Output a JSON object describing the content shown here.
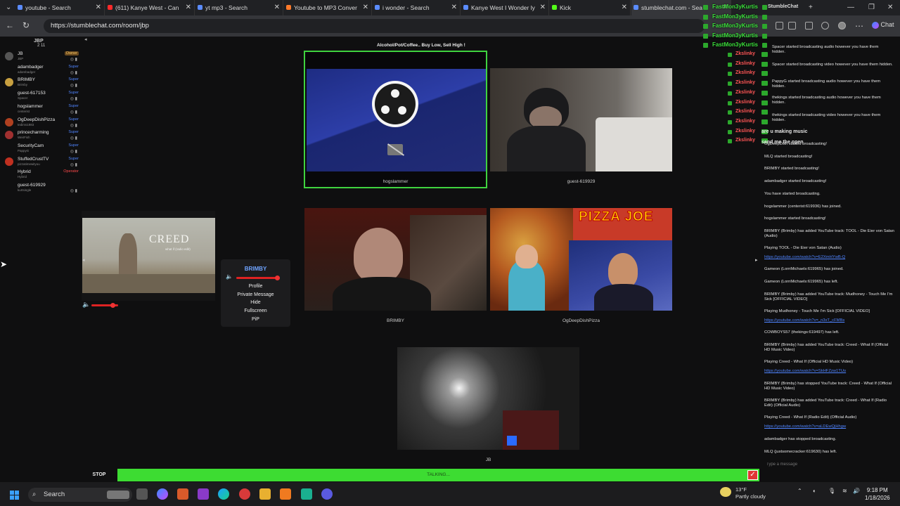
{
  "browser": {
    "tabs": [
      {
        "label": "youtube - Search",
        "color": "#5b8cff"
      },
      {
        "label": "(611) Kanye West - Can",
        "color": "#ff2a2a"
      },
      {
        "label": "yt mp3 - Search",
        "color": "#5b8cff"
      },
      {
        "label": "Youtube to MP3 Conver",
        "color": "#ff7a2a"
      },
      {
        "label": "i wonder - Search",
        "color": "#5b8cff"
      },
      {
        "label": "Kanye West I Wonder ly",
        "color": "#5b8cff"
      },
      {
        "label": "Kick",
        "color": "#53fc18"
      },
      {
        "label": "stumblechat.com - Sea",
        "color": "#5b8cff"
      }
    ],
    "url": "https://stumblechat.com/room/jbp",
    "chat_button": "Chat"
  },
  "room": {
    "name": "JBP",
    "count": "2 11",
    "topic": "Alcohol/Pot/Coffee.. Buy Low, Sell High !"
  },
  "users": [
    {
      "name": "JB",
      "sub": "JBP",
      "role": "Owner",
      "roleType": "owner",
      "avatar": "#555"
    },
    {
      "name": "adambadger",
      "sub": "adambadger",
      "role": "Super",
      "roleType": "super",
      "avatar": ""
    },
    {
      "name": "BRIMBY",
      "sub": "Brimby",
      "role": "Super",
      "roleType": "super",
      "avatar": "#c8a040"
    },
    {
      "name": "guest-617153",
      "sub": "Spacer",
      "role": "Super",
      "roleType": "super",
      "avatar": ""
    },
    {
      "name": "hogslammer",
      "sub": "centerist",
      "role": "Super",
      "roleType": "super",
      "avatar": ""
    },
    {
      "name": "OgDeepDishPizza",
      "sub": "tedims1983",
      "role": "Super",
      "roleType": "super",
      "avatar": "#b04020"
    },
    {
      "name": "princecharming",
      "sub": "WeirFish",
      "role": "Super",
      "roleType": "super",
      "avatar": "#a03030"
    },
    {
      "name": "SecurityCam",
      "sub": "PappyG",
      "role": "Super",
      "roleType": "super",
      "avatar": ""
    },
    {
      "name": "StuffedCrustTV",
      "sub": "pizzatimewityou",
      "role": "Super",
      "roleType": "super",
      "avatar": "#c03020"
    },
    {
      "name": "Hybrid",
      "sub": "Hybrid",
      "role": "Operator",
      "roleType": "op",
      "avatar": ""
    },
    {
      "name": "guest-619929",
      "sub": "kurtsingle",
      "role": "",
      "roleType": "",
      "avatar": ""
    }
  ],
  "cams": {
    "hogslammer": "hogslammer",
    "guest": "guest-619929",
    "brimby": "BRIMBY",
    "pizza": "OgDeepDishPizza",
    "pizza_banner": "PIZZA JOE",
    "jb": "JB"
  },
  "media": {
    "title": "CREED",
    "subtitle": "what if (radio edit)",
    "volume": 0.78
  },
  "context_menu": {
    "title": "BRIMBY",
    "volume": 0.85,
    "items": [
      "Profile",
      "Private Message",
      "Hide",
      "Fullscreen",
      "PiP"
    ]
  },
  "bottom": {
    "stop": "STOP",
    "talking": "TALKING..."
  },
  "overlay_names": [
    "FastMon3yKurtis",
    "FastMon3yKurtis",
    "FastMon3yKurtis",
    "FastMon3yKurtis",
    "FastMon3yKurtis"
  ],
  "overlay_chat": "StumbleChat",
  "zk_names": [
    "Zkslinky",
    "Zkslinky",
    "Zkslinky",
    "Zkslinky",
    "Zkslinky",
    "Zkslinky",
    "Zkslinky",
    "Zkslinky",
    "Zkslinky",
    "Zkslinky"
  ],
  "chat": {
    "messages": [
      {
        "t": "Spacer started broadcasting audio however you have them hidden.",
        "k": "n"
      },
      {
        "t": "Spacer started broadcasting video however you have them hidden.",
        "k": "n"
      },
      {
        "t": "PappyG started broadcasting audio however you have them hidden.",
        "k": "n"
      },
      {
        "t": "thekings started broadcasting audio however you have them hidden.",
        "k": "n"
      },
      {
        "t": "thekings started broadcasting video however you have them hidden.",
        "k": "n"
      },
      {
        "t": "are u making music",
        "k": "b"
      },
      {
        "t": "send me the open",
        "k": "b"
      },
      {
        "t": "OgDeepDish started broadcasting!",
        "k": "n"
      },
      {
        "t": "MLQ started broadcasting!",
        "k": "n"
      },
      {
        "t": "BRIMBY started broadcasting!",
        "k": "n"
      },
      {
        "t": "adambadger started broadcasting!",
        "k": "n"
      },
      {
        "t": "You have started broadcasting.",
        "k": "n"
      },
      {
        "t": "hogslammer (centerist:619936) has joined.",
        "k": "n"
      },
      {
        "t": "hogslammer started broadcasting!",
        "k": "n"
      },
      {
        "t": "BRIMBY (Brimby) has added YouTube track: TOOL - Die Eier von Satan (Audio)",
        "k": "n"
      },
      {
        "t": "Playing TOOL - Die Eier von Satan (Audio)",
        "k": "n"
      },
      {
        "t": "https://youtube.com/watch?v=E2XmHYwB-Q",
        "k": "l"
      },
      {
        "t": "Gameon (LornMichaels:619965) has joined.",
        "k": "n"
      },
      {
        "t": "Gameon (LornMichaels:619965) has left.",
        "k": "n"
      },
      {
        "t": "BRIMBY (Brimby) has added YouTube track: Mudhoney - Touch Me I'm Sick [OFFICIAL VIDEO]",
        "k": "n"
      },
      {
        "t": "Playing Mudhoney - Touch Me I'm Sick [OFFICIAL VIDEO]",
        "k": "n"
      },
      {
        "t": "https://youtube.com/watch?v=_n3xT_cFMBs",
        "k": "l"
      },
      {
        "t": "COWBOYS57 (thekings:619497) has left.",
        "k": "n"
      },
      {
        "t": "BRIMBY (Brimby) has added YouTube track: Creed - What If (Official HD Music Video)",
        "k": "n"
      },
      {
        "t": "Playing Creed - What If (Official HD Music Video)",
        "k": "n"
      },
      {
        "t": "https://youtube.com/watch?v=SkHFZzw1TUo",
        "k": "l"
      },
      {
        "t": "BRIMBY (Brimby) has stopped YouTube track: Creed - What If (Official HD Music Video)",
        "k": "n"
      },
      {
        "t": "BRIMBY (Brimby) has added YouTube track: Creed - What If (Radio Edit) (Official Audio)",
        "k": "n"
      },
      {
        "t": "Playing Creed - What If (Radio Edit) (Official Audio)",
        "k": "n"
      },
      {
        "t": "https://youtube.com/watch?v=aLDEwQjHhgw",
        "k": "l"
      },
      {
        "t": "adambadger has stopped broadcasting.",
        "k": "n"
      },
      {
        "t": "MLQ (justsomecracker:619630) has left.",
        "k": "n"
      }
    ],
    "input_placeholder": "Type a message"
  },
  "taskbar": {
    "search": "Search",
    "weather_temp": "13°F",
    "weather_desc": "Partly cloudy",
    "time": "9:18 PM",
    "date": "1/18/2026"
  }
}
